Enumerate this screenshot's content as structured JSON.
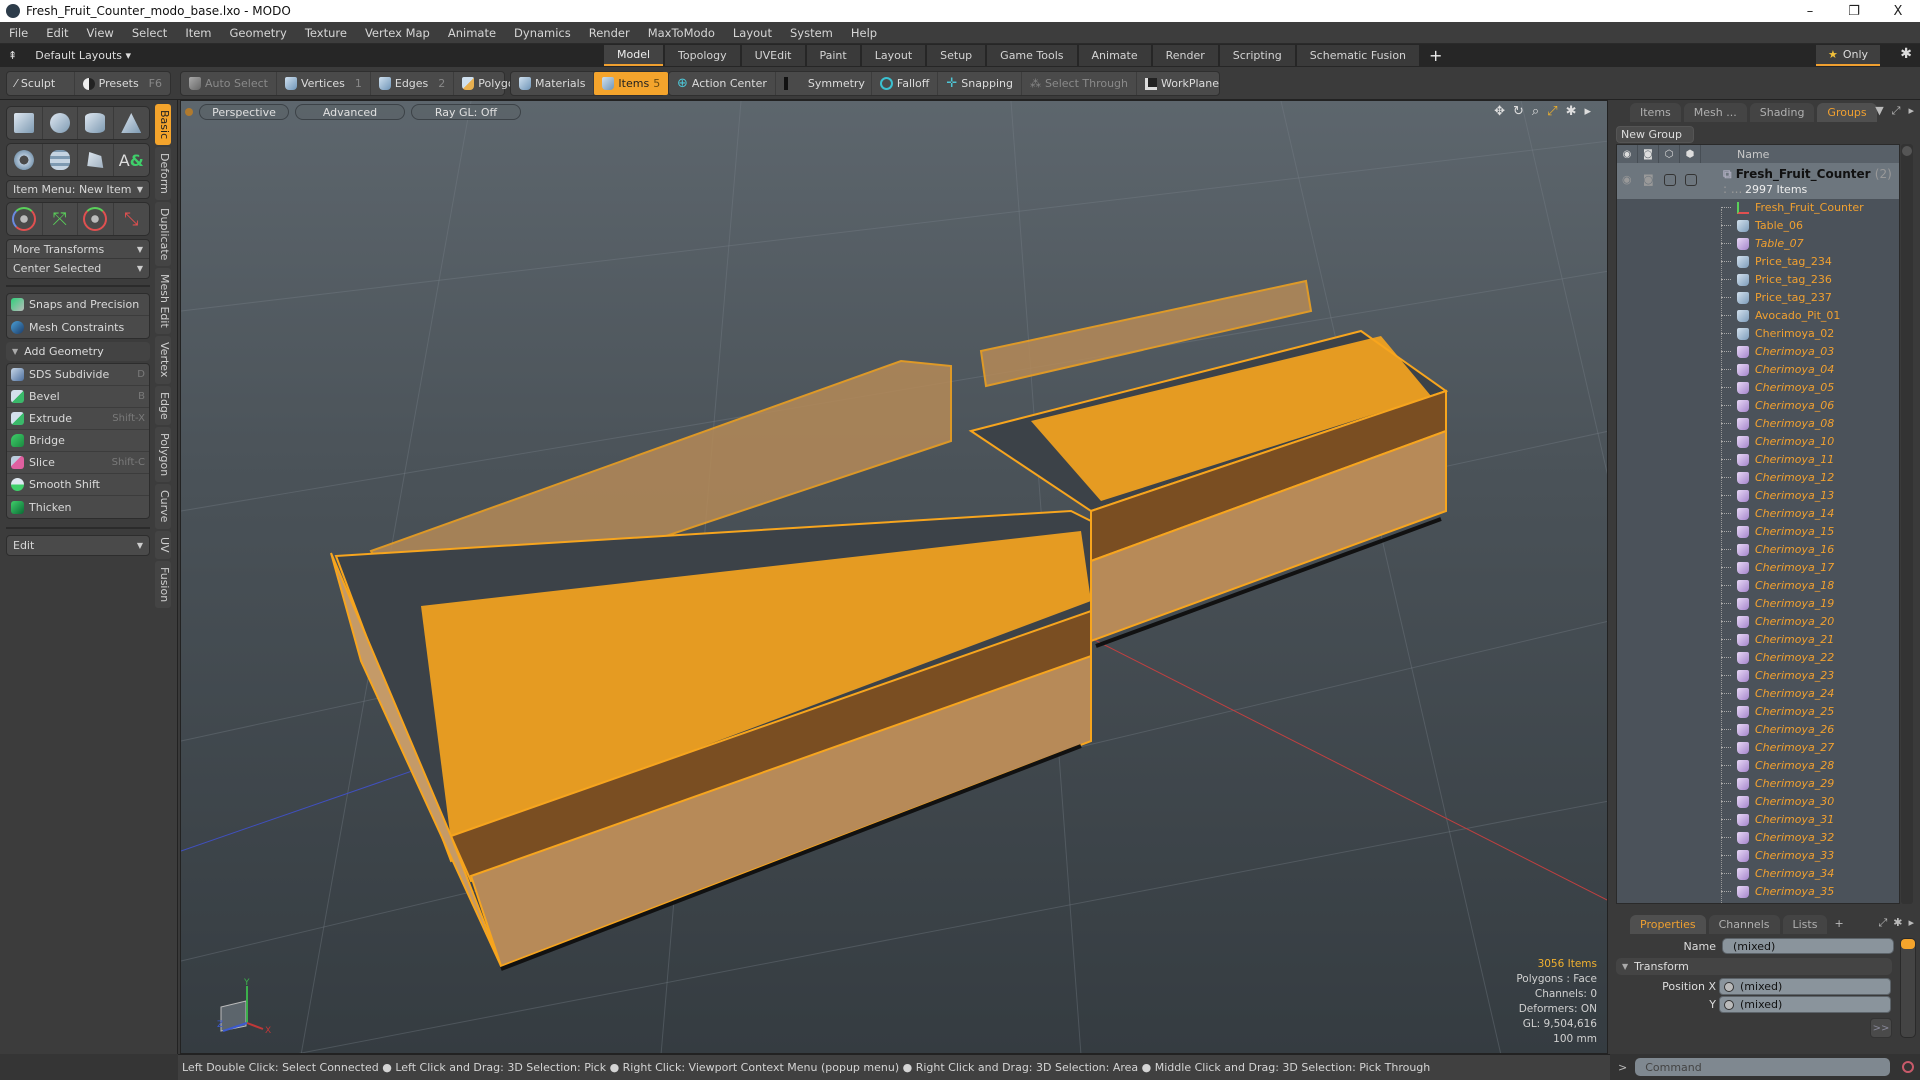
{
  "window": {
    "title": "Fresh_Fruit_Counter_modo_base.lxo - MODO",
    "controls": {
      "minimize": "–",
      "maximize": "❐",
      "close": "X"
    }
  },
  "menu": [
    "File",
    "Edit",
    "View",
    "Select",
    "Item",
    "Geometry",
    "Texture",
    "Vertex Map",
    "Animate",
    "Dynamics",
    "Render",
    "MaxToModo",
    "Layout",
    "System",
    "Help"
  ],
  "layout_bar": {
    "layouts_label": "Default Layouts ▾",
    "tabs": [
      "Model",
      "Topology",
      "UVEdit",
      "Paint",
      "Layout",
      "Setup",
      "Game Tools",
      "Animate",
      "Render",
      "Scripting",
      "Schematic Fusion"
    ],
    "active_tab": "Model",
    "add_tab": "+",
    "only_label": "Only"
  },
  "toolbar": {
    "sculpt": "Sculpt",
    "presets": "Presets",
    "presets_key": "F6",
    "auto_select": "Auto Select",
    "vertices": "Vertices",
    "vertices_key": "1",
    "edges": "Edges",
    "edges_key": "2",
    "polygons": "Polygons",
    "materials": "Materials",
    "items": "Items",
    "items_key": "5",
    "action_center": "Action Center",
    "symmetry": "Symmetry",
    "falloff": "Falloff",
    "snapping": "Snapping",
    "select_through": "Select Through",
    "workplane": "WorkPlane"
  },
  "left_panel": {
    "item_menu": "Item Menu: New Item",
    "more_transforms": "More Transforms",
    "center_selected": "Center Selected",
    "snaps": "Snaps and Precision",
    "mesh_constraints": "Mesh Constraints",
    "add_geometry": "Add Geometry",
    "tools": [
      {
        "label": "SDS Subdivide",
        "key": "D"
      },
      {
        "label": "Bevel",
        "key": "B"
      },
      {
        "label": "Extrude",
        "key": "Shift-X"
      },
      {
        "label": "Bridge",
        "key": ""
      },
      {
        "label": "Slice",
        "key": "Shift-C"
      },
      {
        "label": "Smooth Shift",
        "key": ""
      },
      {
        "label": "Thicken",
        "key": ""
      }
    ],
    "edit_dropdown": "Edit",
    "vertical_tabs": [
      "Basic",
      "Deform",
      "Duplicate",
      "Mesh Edit",
      "Vertex",
      "Edge",
      "Polygon",
      "Curve",
      "UV",
      "Fusion"
    ],
    "active_vertical_tab": "Basic"
  },
  "viewport": {
    "view": "Perspective",
    "shading": "Advanced",
    "raygl": "Ray GL: Off",
    "info": {
      "items": "3056 Items",
      "polygons": "Polygons : Face",
      "channels": "Channels: 0",
      "deformers": "Deformers: ON",
      "gl": "GL: 9,504,616",
      "unit": "100 mm"
    },
    "axis_labels": {
      "x": "X",
      "y": "Y",
      "z": "Z"
    },
    "colors": {
      "selection": "#f7a51e",
      "wood": "#b78a58",
      "wood_dark": "#7a4e22"
    }
  },
  "right_panel": {
    "tabs": [
      "Items",
      "Mesh ...",
      "Shading",
      "Groups"
    ],
    "active_tab": "Groups",
    "new_group": "New Group",
    "column_name": "Name",
    "group": {
      "name": "Fresh_Fruit_Counter",
      "count": "(2) : ...",
      "subtitle": "2997 Items"
    },
    "items": [
      {
        "name": "Fresh_Fruit_Counter",
        "type": "locator",
        "italic": false
      },
      {
        "name": "Table_06",
        "type": "mesh",
        "italic": false
      },
      {
        "name": "Table_07",
        "type": "instance",
        "italic": true
      },
      {
        "name": "Price_tag_234",
        "type": "mesh",
        "italic": false
      },
      {
        "name": "Price_tag_236",
        "type": "mesh",
        "italic": false
      },
      {
        "name": "Price_tag_237",
        "type": "mesh",
        "italic": false
      },
      {
        "name": "Avocado_Pit_01",
        "type": "mesh",
        "italic": false
      },
      {
        "name": "Cherimoya_02",
        "type": "mesh",
        "italic": false
      },
      {
        "name": "Cherimoya_03",
        "type": "instance",
        "italic": true
      },
      {
        "name": "Cherimoya_04",
        "type": "instance",
        "italic": true
      },
      {
        "name": "Cherimoya_05",
        "type": "instance",
        "italic": true
      },
      {
        "name": "Cherimoya_06",
        "type": "instance",
        "italic": true
      },
      {
        "name": "Cherimoya_08",
        "type": "instance",
        "italic": true
      },
      {
        "name": "Cherimoya_10",
        "type": "instance",
        "italic": true
      },
      {
        "name": "Cherimoya_11",
        "type": "instance",
        "italic": true
      },
      {
        "name": "Cherimoya_12",
        "type": "instance",
        "italic": true
      },
      {
        "name": "Cherimoya_13",
        "type": "instance",
        "italic": true
      },
      {
        "name": "Cherimoya_14",
        "type": "instance",
        "italic": true
      },
      {
        "name": "Cherimoya_15",
        "type": "instance",
        "italic": true
      },
      {
        "name": "Cherimoya_16",
        "type": "instance",
        "italic": true
      },
      {
        "name": "Cherimoya_17",
        "type": "instance",
        "italic": true
      },
      {
        "name": "Cherimoya_18",
        "type": "instance",
        "italic": true
      },
      {
        "name": "Cherimoya_19",
        "type": "instance",
        "italic": true
      },
      {
        "name": "Cherimoya_20",
        "type": "instance",
        "italic": true
      },
      {
        "name": "Cherimoya_21",
        "type": "instance",
        "italic": true
      },
      {
        "name": "Cherimoya_22",
        "type": "instance",
        "italic": true
      },
      {
        "name": "Cherimoya_23",
        "type": "instance",
        "italic": true
      },
      {
        "name": "Cherimoya_24",
        "type": "instance",
        "italic": true
      },
      {
        "name": "Cherimoya_25",
        "type": "instance",
        "italic": true
      },
      {
        "name": "Cherimoya_26",
        "type": "instance",
        "italic": true
      },
      {
        "name": "Cherimoya_27",
        "type": "instance",
        "italic": true
      },
      {
        "name": "Cherimoya_28",
        "type": "instance",
        "italic": true
      },
      {
        "name": "Cherimoya_29",
        "type": "instance",
        "italic": true
      },
      {
        "name": "Cherimoya_30",
        "type": "instance",
        "italic": true
      },
      {
        "name": "Cherimoya_31",
        "type": "instance",
        "italic": true
      },
      {
        "name": "Cherimoya_32",
        "type": "instance",
        "italic": true
      },
      {
        "name": "Cherimoya_33",
        "type": "instance",
        "italic": true
      },
      {
        "name": "Cherimoya_34",
        "type": "instance",
        "italic": true
      },
      {
        "name": "Cherimoya_35",
        "type": "instance",
        "italic": true
      }
    ]
  },
  "properties": {
    "tabs": [
      "Properties",
      "Channels",
      "Lists"
    ],
    "active_tab": "Properties",
    "add_tab": "+",
    "name_label": "Name",
    "name_value": "(mixed)",
    "transform_label": "Transform",
    "position_x_label": "Position X",
    "position_x_value": "(mixed)",
    "position_y_label": "Y",
    "position_y_value": "(mixed)",
    "more_button": ">>"
  },
  "command": {
    "prompt": ">",
    "placeholder": "Command"
  },
  "status_bar": "Left Double Click: Select Connected ● Left Click and Drag: 3D Selection: Pick ● Right Click: Viewport Context Menu (popup menu) ● Right Click and Drag: 3D Selection: Area ● Middle Click and Drag: 3D Selection: Pick Through"
}
